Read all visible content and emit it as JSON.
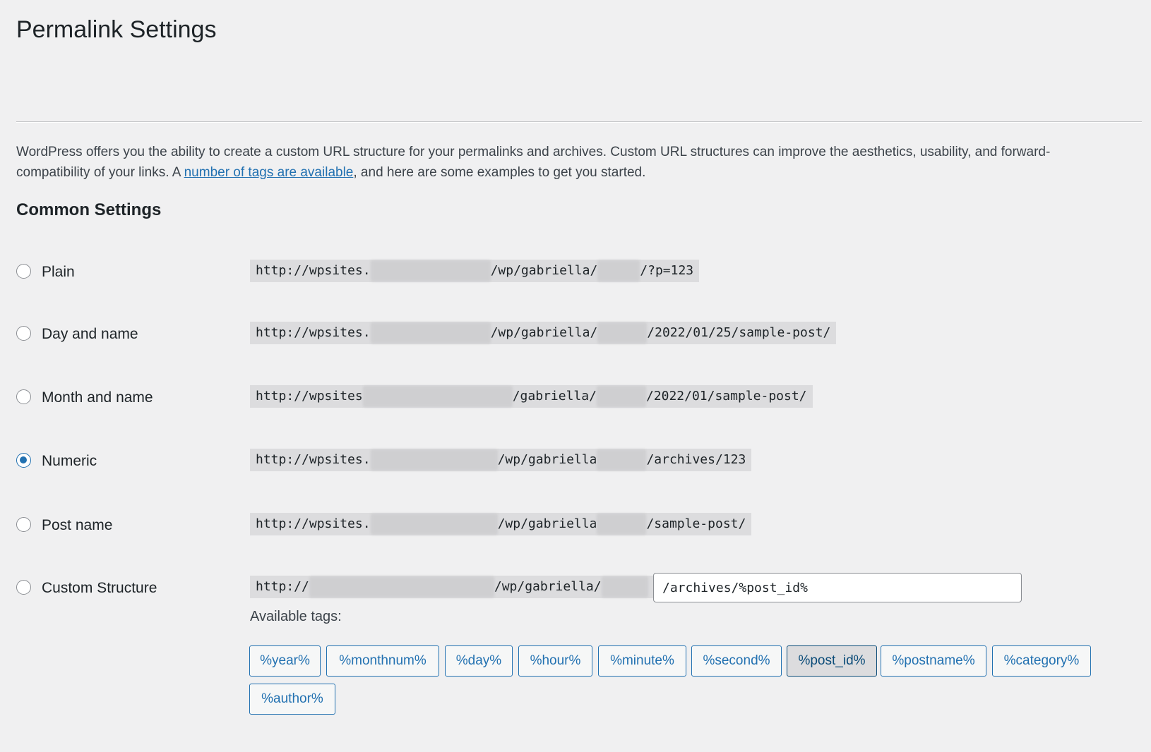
{
  "page": {
    "title": "Permalink Settings",
    "intro_before_link": "WordPress offers you the ability to create a custom URL structure for your permalinks and archives. Custom URL structures can improve the aesthetics, usability, and forward-compatibility of your links. A ",
    "intro_link": "number of tags are available",
    "intro_after_link": ", and here are some examples to get you started."
  },
  "common": {
    "title": "Common Settings",
    "options": [
      {
        "label": "Plain",
        "checked": false,
        "url_start": "http://wpsites.",
        "url_middle": "/wp/gabriella/",
        "url_end": "/?p=123"
      },
      {
        "label": "Day and name",
        "checked": false,
        "url_start": "http://wpsites.",
        "url_middle": "/wp/gabriella/",
        "url_end": "/2022/01/25/sample-post/"
      },
      {
        "label": "Month and name",
        "checked": false,
        "url_start": "http://wpsites",
        "url_middle": "/gabriella/",
        "url_end": "/2022/01/sample-post/"
      },
      {
        "label": "Numeric",
        "checked": true,
        "url_start": "http://wpsites.",
        "url_middle": "/wp/gabriella",
        "url_end": "/archives/123"
      },
      {
        "label": "Post name",
        "checked": false,
        "url_start": "http://wpsites.",
        "url_middle": "/wp/gabriella",
        "url_end": "/sample-post/"
      },
      {
        "label": "Custom Structure",
        "checked": false,
        "url_start": "http://",
        "url_middle": "/wp/gabriella/",
        "url_end": ""
      }
    ],
    "custom_value": "/archives/%post_id%",
    "available_tags_label": "Available tags:",
    "tags": [
      {
        "label": "%year%",
        "active": false
      },
      {
        "label": "%monthnum%",
        "active": false
      },
      {
        "label": "%day%",
        "active": false
      },
      {
        "label": "%hour%",
        "active": false
      },
      {
        "label": "%minute%",
        "active": false
      },
      {
        "label": "%second%",
        "active": false
      },
      {
        "label": "%post_id%",
        "active": true
      },
      {
        "label": "%postname%",
        "active": false
      },
      {
        "label": "%category%",
        "active": false
      },
      {
        "label": "%author%",
        "active": false
      }
    ]
  },
  "colors": {
    "background": "#f0f0f1",
    "accent": "#2271b1",
    "text": "#1d2327",
    "code_bg": "#dcdcde"
  }
}
